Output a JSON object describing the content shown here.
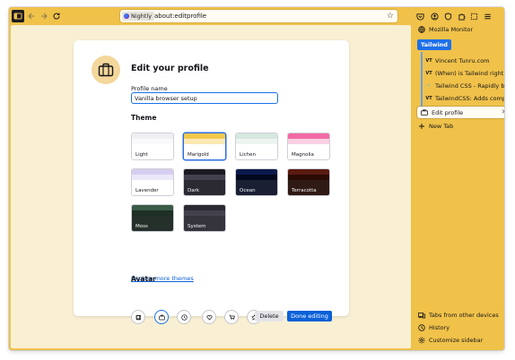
{
  "browser": {
    "identity_label": "Nightly",
    "url": "about:editprofile"
  },
  "sidebar": {
    "top_item": "Mozilla Monitor",
    "group_name": "Tailwind",
    "group_tabs": [
      {
        "favicon": "VT",
        "label": "Vincent Tunru.com"
      },
      {
        "favicon": "VT",
        "label": "(When) is Tailwind right for"
      },
      {
        "favicon": "~",
        "label": "Tailwind CSS - Rapidly build"
      },
      {
        "favicon": "VT",
        "label": "TailwindCSS: Adds complex"
      }
    ],
    "active_tab": "Edit profile",
    "new_tab": "New Tab",
    "bottom": [
      "Tabs from other devices",
      "History",
      "Customize sidebar"
    ]
  },
  "profile": {
    "title": "Edit your profile",
    "name_label": "Profile name",
    "name_value": "Vanilla browser setup",
    "theme_heading": "Theme",
    "themes": [
      {
        "name": "Light",
        "c1": "#f0f0f4",
        "c2": "#f9f9fb",
        "body": "#ffffff",
        "selected": false
      },
      {
        "name": "Marigold",
        "c1": "#f2c94c",
        "c2": "#fbe9b3",
        "body": "#ffffff",
        "selected": true
      },
      {
        "name": "Lichen",
        "c1": "#d6e8e0",
        "c2": "#edf5f1",
        "body": "#ffffff",
        "selected": false
      },
      {
        "name": "Magnolia",
        "c1": "#f26aa5",
        "c2": "#fbd0e2",
        "body": "#ffffff",
        "selected": false
      },
      {
        "name": "Lavender",
        "c1": "#d7cdf0",
        "c2": "#ece7f9",
        "body": "#ffffff",
        "selected": false
      },
      {
        "name": "Dark",
        "c1": "#1c1b22",
        "c2": "#42414d",
        "body": "#2b2a33",
        "selected": false
      },
      {
        "name": "Ocean",
        "c1": "#0b1a4a",
        "c2": "#02091f",
        "body": "#1a1f33",
        "selected": false
      },
      {
        "name": "Terracotta",
        "c1": "#5a1a10",
        "c2": "#2a0b06",
        "body": "#301a15",
        "selected": false
      },
      {
        "name": "Moss",
        "c1": "#3a5a45",
        "c2": "#1e2f25",
        "body": "#25302a",
        "selected": false
      },
      {
        "name": "System",
        "c1": "#2b2a33",
        "c2": "#42414d",
        "body": "#35343c",
        "selected": false
      }
    ],
    "explore_link": "Explore more themes",
    "avatar_heading": "Avatar",
    "avatars": [
      "book-icon",
      "briefcase-icon",
      "clock-icon",
      "heart-icon",
      "cart-icon",
      "star-icon"
    ],
    "selected_avatar": 1,
    "delete_label": "Delete",
    "done_label": "Done editing"
  },
  "colors": {
    "accent": "#0a60d8",
    "window": "#f0c24a",
    "content_bg": "#f9f0d4",
    "group": "#1f6fe8"
  }
}
